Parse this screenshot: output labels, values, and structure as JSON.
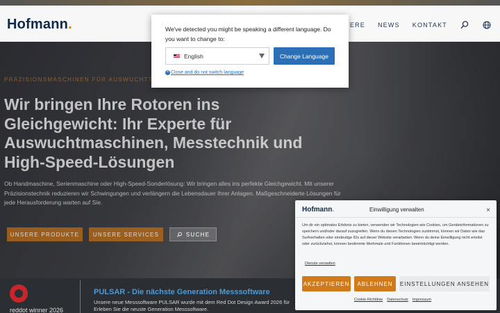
{
  "header": {
    "logo": "Hofmann",
    "logo_dot": ".",
    "nav": [
      "KARRIERE",
      "NEWS",
      "KONTAKT"
    ]
  },
  "hero": {
    "eyebrow": "PRÄZISIONSMASCHINEN FÜR AUSWUCHTTECHNIK",
    "headline": "Wir bringen Ihre Rotoren ins Gleichgewicht: Ihr Experte für Auswuchtmaschinen, Messtechnik und High-Speed-Lösungen",
    "lead": "Ob Handmaschine, Serienmaschine oder High-Speed-Sonderlösung: Wir bringen alles ins perfekte Gleichgewicht. Mit unserer Präzisionstechnik reduzieren wir Schwingungen und verlängern die Lebensdauer Ihrer Anlagen. Maßgeschneiderte Lösungen für jede Herausforderung warten auf Sie.",
    "buttons": {
      "products": "UNSERE PRODUKTE",
      "services": "UNSERE SERVICES",
      "search": "SUCHE"
    }
  },
  "news": {
    "award_caption": "reddot winner 2026",
    "title": "PULSAR - Die nächste Generation Messsoftware",
    "text": "Unsere neue Messsoftware PULSAR wurde mit dem Red Dot Design Award 2026 für Erleben Sie die neuste Generation Messsoftware."
  },
  "language_dialog": {
    "message": "We've detected you might be speaking a different language. Do you want to change to:",
    "selected_language": "English",
    "button": "Change Language",
    "close_link": "Close and do not switch language"
  },
  "cookie": {
    "logo": "Hofmann",
    "logo_dot": ".",
    "title": "Einwilligung verwalten",
    "close_glyph": "×",
    "text": "Um dir ein optimales Erlebnis zu bieten, verwenden wir Technologien wie Cookies, um Geräteinformationen zu speichern und/oder darauf zuzugreifen. Wenn du diesen Technologien zustimmst, können wir Daten wie das Surfverhalten oder eindeutige IDs auf dieser Website verarbeiten. Wenn du deine Einwilligung nicht erteilst oder zurückziehst, können bestimmte Merkmale und Funktionen beeinträchtigt werden.",
    "services_link": "Dienste verwalten",
    "accept": "AKZEPTIEREN",
    "reject": "ABLEHNEN",
    "settings": "EINSTELLUNGEN ANSEHEN",
    "footer": [
      "Cookie-Richtlinie",
      "Datenschutz",
      "Impressum"
    ]
  },
  "colors": {
    "brand_navy": "#0e2a4a",
    "accent_orange": "#d07a1a",
    "link_blue": "#2c6fb4"
  }
}
